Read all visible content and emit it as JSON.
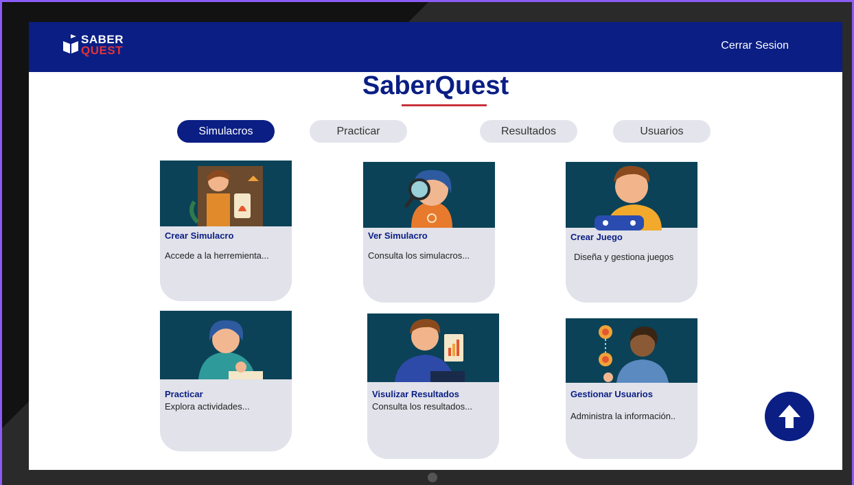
{
  "header": {
    "logo_line1": "SABER",
    "logo_line2": "QUEST",
    "logout_label": "Cerrar Sesion"
  },
  "page_title": "SaberQuest",
  "tabs": [
    {
      "label": "Simulacros",
      "active": true
    },
    {
      "label": "Practicar",
      "active": false
    },
    {
      "label": "Resultados",
      "active": false
    },
    {
      "label": "Usuarios",
      "active": false
    }
  ],
  "cards": [
    {
      "title": "Crear Simulacro",
      "description": "Accede a la herremienta...",
      "icon": "teacher-illustration"
    },
    {
      "title": "Ver Simulacro",
      "description": "Consulta los simulacros...",
      "icon": "magnifier-illustration"
    },
    {
      "title": "Crear Juego",
      "description": "Diseña y gestiona juegos",
      "icon": "gamer-illustration"
    },
    {
      "title": "Practicar",
      "description": "Explora actividades...",
      "icon": "student-writing-illustration"
    },
    {
      "title": "Visulizar Resultados",
      "description": "Consulta los resultados...",
      "icon": "results-chart-illustration"
    },
    {
      "title": "Gestionar Usuarios",
      "description": "Administra la información..",
      "icon": "users-network-illustration"
    }
  ],
  "scroll_top_icon": "arrow-up-icon",
  "colors": {
    "primary": "#0a1e84",
    "accent": "#e2343a",
    "card_bg": "#e1e2ea",
    "image_bg": "#0b4257"
  }
}
